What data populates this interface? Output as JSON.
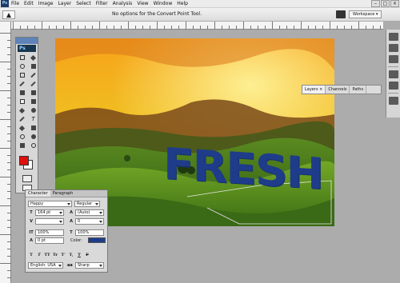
{
  "menu": {
    "logo": "Ps",
    "items": [
      "File",
      "Edit",
      "Image",
      "Layer",
      "Select",
      "Filter",
      "Analysis",
      "View",
      "Window",
      "Help"
    ],
    "window_buttons": [
      "–",
      "□",
      "×"
    ]
  },
  "options_bar": {
    "message": "No options for the Convert Point Tool.",
    "workspace_label": "Workspace ▾"
  },
  "canvas": {
    "overlay_text": "FRESH"
  },
  "tools_panel": {
    "badge": "Ps"
  },
  "layers_panel": {
    "tabs": [
      "Layers ×",
      "Channels",
      "Paths"
    ]
  },
  "character_panel": {
    "tabs": [
      "Character",
      "Paragraph"
    ],
    "font_family": "Happy",
    "font_style": "Regular",
    "font_size": "164 pt",
    "leading": "(Auto)",
    "kerning": "",
    "tracking": "0",
    "vertical_scale": "100%",
    "horizontal_scale": "100%",
    "baseline_shift": "0 pt",
    "color_label": "Color:",
    "language": "English: USA",
    "antialias_prefix": "aa",
    "antialias": "Sharp",
    "style_buttons": [
      "T",
      "T",
      "TT",
      "Tr",
      "T'",
      "T,",
      "T",
      "F"
    ]
  },
  "colors": {
    "text_color": "#1f3c8a",
    "foreground": "#e01010",
    "background": "#ffffff"
  }
}
